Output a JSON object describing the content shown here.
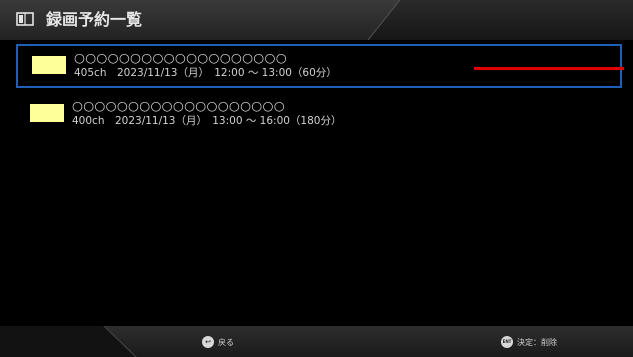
{
  "header": {
    "title": "録画予約一覧",
    "icon": "recording-list-icon"
  },
  "reservations": [
    {
      "title": "○○○○○○○○○○○○○○○○○○○",
      "detail": "405ch　2023/11/13（月）　12:00 ～ 13:00（60分）",
      "selected": true,
      "swatch_color": "#ffff99"
    },
    {
      "title": "○○○○○○○○○○○○○○○○○○○",
      "detail": "400ch　2023/11/13（月）　13:00 ～ 16:00（180分）",
      "selected": false,
      "swatch_color": "#ffff99"
    }
  ],
  "footer": {
    "back_label": "戻る",
    "back_icon": "back-arrow-icon",
    "confirm_label": "決定：削除",
    "confirm_icon": "enter-button-icon"
  },
  "colors": {
    "selection_border": "#1f5fb8",
    "marker": "#e00000",
    "swatch": "#ffff99"
  }
}
